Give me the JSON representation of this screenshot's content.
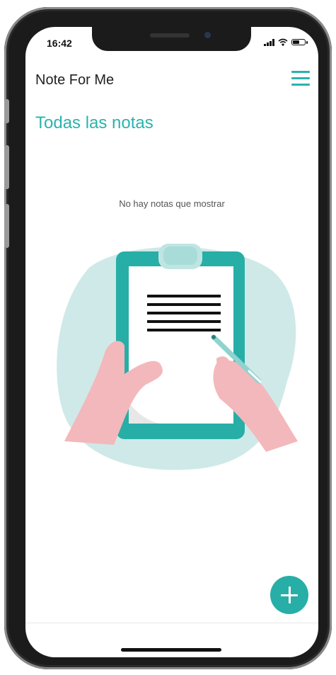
{
  "status_bar": {
    "time": "16:42",
    "icons": [
      "signal-icon",
      "wifi-icon",
      "battery-icon"
    ],
    "battery_level": 0.6
  },
  "header": {
    "title": "Note For Me",
    "menu_icon": "hamburger-menu-icon"
  },
  "main": {
    "section_title": "Todas las notas",
    "empty_message": "No hay notas que mostrar",
    "illustration": "clipboard-writing-illustration"
  },
  "fab": {
    "icon": "plus-icon"
  },
  "colors": {
    "accent": "#2bb3ad",
    "blob": "#cfe9e8",
    "clipboard": "#27aea7",
    "skin": "#f3b8bb"
  }
}
